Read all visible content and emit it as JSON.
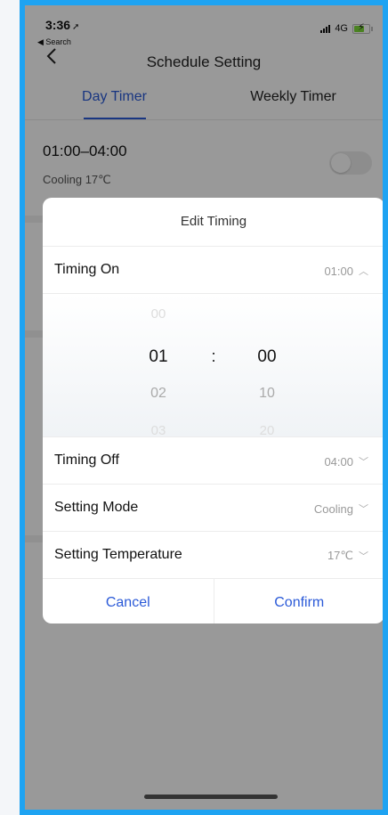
{
  "status_bar": {
    "time": "3:36",
    "back_app": "◀ Search",
    "network": "4G"
  },
  "nav": {
    "title": "Schedule Setting"
  },
  "tabs": [
    {
      "label": "Day Timer",
      "active": true
    },
    {
      "label": "Weekly Timer",
      "active": false
    }
  ],
  "schedule": {
    "time_range": "01:00–04:00",
    "detail": "Cooling 17℃"
  },
  "dialog": {
    "title": "Edit Timing",
    "timing_on": {
      "label": "Timing On",
      "value": "01:00"
    },
    "picker": {
      "hours": [
        "00",
        "01",
        "02",
        "03"
      ],
      "separator": ":",
      "minutes": [
        "",
        "00",
        "10",
        "20"
      ]
    },
    "timing_off": {
      "label": "Timing Off",
      "value": "04:00"
    },
    "setting_mode": {
      "label": "Setting Mode",
      "value": "Cooling"
    },
    "setting_temperature": {
      "label": "Setting Temperature",
      "value": "17℃"
    },
    "cancel_label": "Cancel",
    "confirm_label": "Confirm"
  },
  "colors": {
    "accent": "#2b5ad8",
    "frame": "#1ea3f2"
  }
}
